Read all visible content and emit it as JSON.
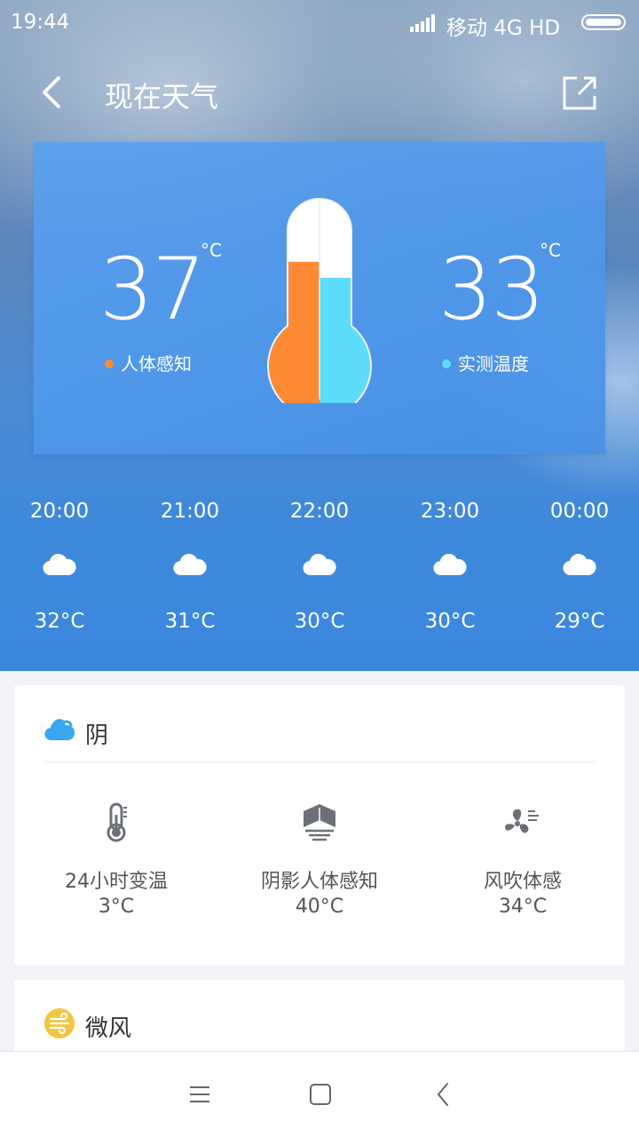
{
  "status_bar": {
    "time": "19:44",
    "carrier": "移动 4G HD"
  },
  "header": {
    "title": "现在天气"
  },
  "temperature_card": {
    "feels_like": {
      "value": "37",
      "unit": "°C",
      "label": "人体感知",
      "color": "#ff8a36"
    },
    "measured": {
      "value": "33",
      "unit": "°C",
      "label": "实测温度",
      "color": "#5ddcfb"
    }
  },
  "hourly": [
    {
      "time": "20:00",
      "icon": "cloud-icon",
      "temp": "32°C"
    },
    {
      "time": "21:00",
      "icon": "cloud-icon",
      "temp": "31°C"
    },
    {
      "time": "22:00",
      "icon": "cloud-icon",
      "temp": "30°C"
    },
    {
      "time": "23:00",
      "icon": "cloud-icon",
      "temp": "30°C"
    },
    {
      "time": "00:00",
      "icon": "cloud-icon",
      "temp": "29°C"
    }
  ],
  "condition_panel": {
    "title": "阴",
    "icon": "cloudy-icon",
    "metrics": [
      {
        "icon": "thermometer-icon",
        "label": "24小时变温",
        "value": "3°C"
      },
      {
        "icon": "shade-icon",
        "label": "阴影人体感知",
        "value": "40°C"
      },
      {
        "icon": "fan-wind-icon",
        "label": "风吹体感",
        "value": "34°C"
      }
    ]
  },
  "wind_panel": {
    "title": "微风",
    "icon": "wind-icon",
    "icon_color": "#f5c542"
  },
  "colors": {
    "accent_blue": "#3a88de",
    "cloud_icon_blue": "#3aa6ee"
  }
}
